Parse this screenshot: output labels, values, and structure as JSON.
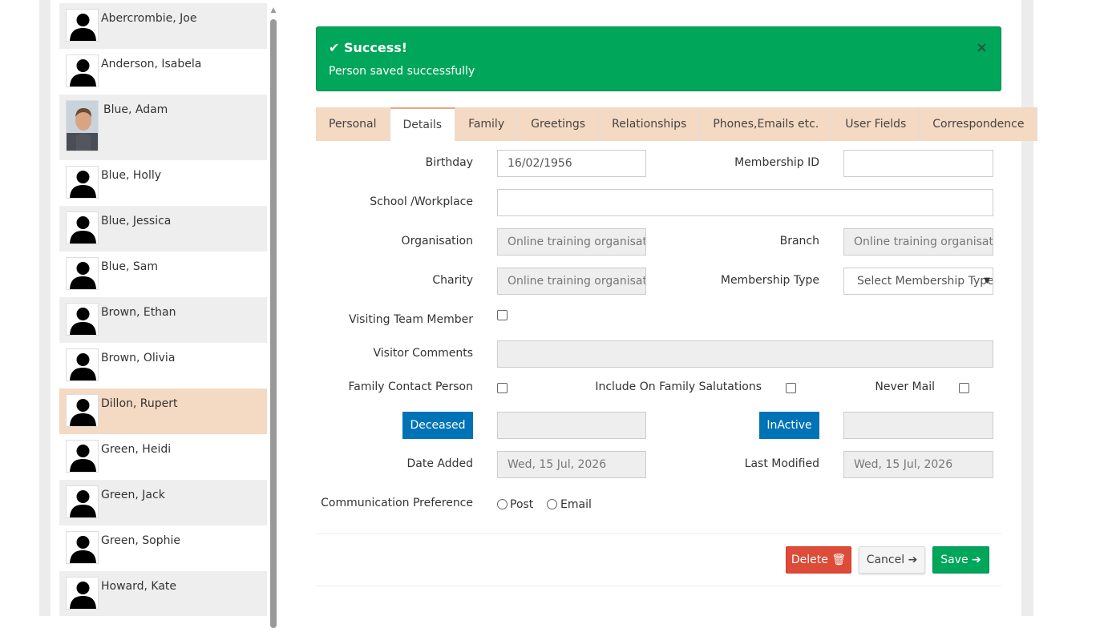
{
  "people": [
    {
      "name": "Abercrombie, Joe",
      "photo": "silhouette"
    },
    {
      "name": "Anderson, Isabela",
      "photo": "silhouette"
    },
    {
      "name": "Blue, Adam",
      "photo": "portrait"
    },
    {
      "name": "Blue, Holly",
      "photo": "silhouette"
    },
    {
      "name": "Blue, Jessica",
      "photo": "silhouette"
    },
    {
      "name": "Blue, Sam",
      "photo": "silhouette"
    },
    {
      "name": "Brown, Ethan",
      "photo": "silhouette"
    },
    {
      "name": "Brown, Olivia",
      "photo": "silhouette"
    },
    {
      "name": "Dillon, Rupert",
      "photo": "silhouette",
      "selected": true
    },
    {
      "name": "Green, Heidi",
      "photo": "silhouette"
    },
    {
      "name": "Green, Jack",
      "photo": "silhouette"
    },
    {
      "name": "Green, Sophie",
      "photo": "silhouette"
    },
    {
      "name": "Howard, Kate",
      "photo": "silhouette"
    }
  ],
  "alert": {
    "title": "Success!",
    "message": "Person saved successfully",
    "close": "×",
    "color": "#00a65a"
  },
  "tabs": [
    "Personal",
    "Details",
    "Family",
    "Greetings",
    "Relationships",
    "Phones,Emails etc.",
    "User Fields",
    "Correspondence"
  ],
  "active_tab": "Details",
  "form": {
    "birthday_label": "Birthday",
    "birthday_value": "16/02/1956",
    "membership_id_label": "Membership ID",
    "membership_id_value": "",
    "school_label": "School /Workplace",
    "school_value": "",
    "organisation_label": "Organisation",
    "organisation_value": "Online training organisation",
    "branch_label": "Branch",
    "branch_value": "Online training organisation",
    "charity_label": "Charity",
    "charity_value": "Online training organisation",
    "membership_type_label": "Membership Type",
    "membership_type_value": "Select Membership Type",
    "visiting_label": "Visiting Team Member",
    "visitor_comments_label": "Visitor Comments",
    "family_contact_label": "Family Contact Person",
    "include_salutations_label": "Include On Family Salutations",
    "never_mail_label": "Never Mail",
    "deceased_button": "Deceased",
    "inactive_button": "InActive",
    "date_added_label": "Date Added",
    "date_added_value": "Wed, 15 Jul, 2026",
    "last_modified_label": "Last Modified",
    "last_modified_value": "Wed, 15 Jul, 2026",
    "comm_pref_label": "Communication Preference",
    "comm_post": "Post",
    "comm_email": "Email"
  },
  "buttons": {
    "delete": "Delete",
    "cancel": "Cancel",
    "save": "Save"
  },
  "colors": {
    "accent_tab": "#f4d9c3",
    "primary_blue": "#0073b7",
    "danger": "#dd4b39",
    "success": "#00a65a"
  }
}
